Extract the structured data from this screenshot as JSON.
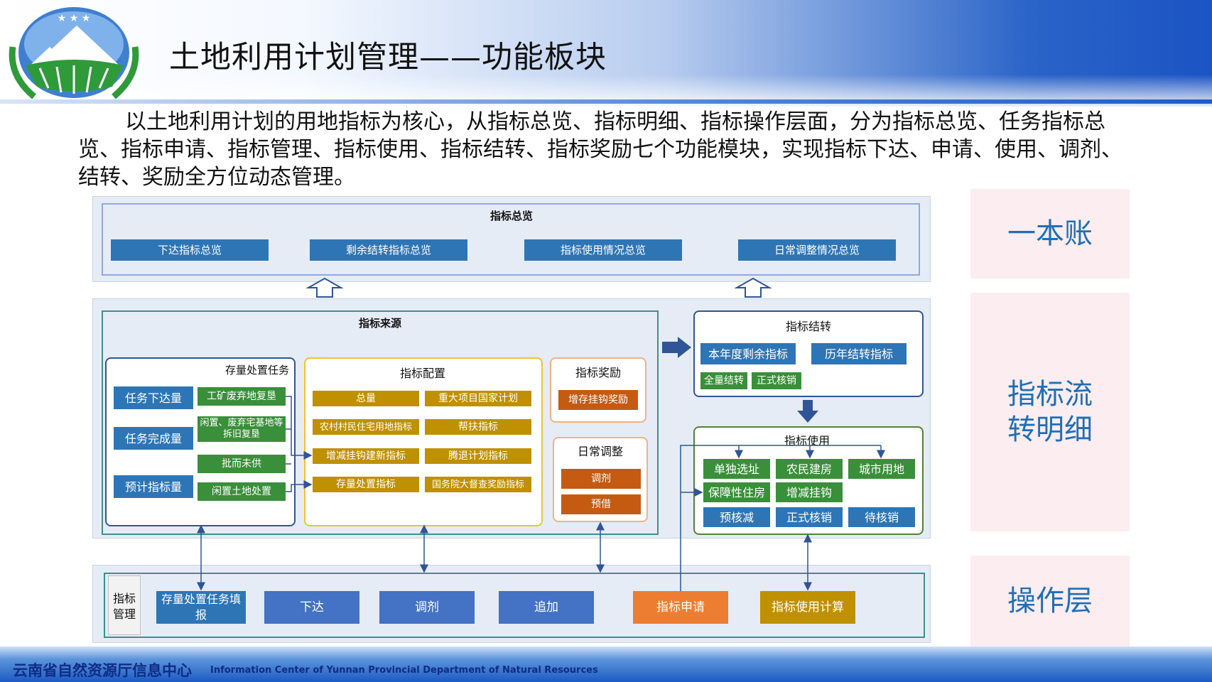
{
  "header": {
    "title": "土地利用计划管理——功能板块"
  },
  "intro": "以土地利用计划的用地指标为核心，从指标总览、指标明细、指标操作层面，分为指标总览、任务指标总览、指标申请、指标管理、指标使用、指标结转、指标奖励七个功能模块，实现指标下达、申请、使用、调剂、结转、奖励全方位动态管理。",
  "overview": {
    "title": "指标总览",
    "items": [
      "下达指标总览",
      "剩余结转指标总览",
      "指标使用情况总览",
      "日常调整情况总览"
    ]
  },
  "source": {
    "title": "指标来源",
    "stock": {
      "title": "存量处置任务",
      "left": [
        "任务下达量",
        "任务完成量",
        "预计指标量"
      ],
      "right": [
        "工矿废弃地复垦",
        "闲置、废弃宅基地等拆旧复垦",
        "批而未供",
        "闲置土地处置"
      ]
    },
    "config": {
      "title": "指标配置",
      "items": [
        "总量",
        "重大项目国家计划",
        "农村村民住宅用地指标",
        "帮扶指标",
        "增减挂钩建新指标",
        "腾退计划指标",
        "存量处置指标",
        "国务院大督查奖励指标"
      ]
    },
    "reward": {
      "title": "指标奖励",
      "item": "增存挂钩奖励"
    },
    "daily": {
      "title": "日常调整",
      "items": [
        "调剂",
        "预借"
      ]
    }
  },
  "carryover": {
    "title": "指标结转",
    "items": [
      "本年度剩余指标",
      "历年结转指标",
      "全量结转",
      "正式核销"
    ]
  },
  "usage": {
    "title": "指标使用",
    "items": [
      "单独选址",
      "农民建房",
      "城市用地",
      "保障性住房",
      "增减挂钩",
      "预核减",
      "正式核销",
      "待核销"
    ]
  },
  "operation": {
    "label": "指标管理",
    "buttons": [
      "存量处置任务填报",
      "下达",
      "调剂",
      "追加",
      "指标申请",
      "指标使用计算"
    ]
  },
  "side_labels": [
    "一本账",
    "指标流转明细",
    "操作层"
  ],
  "footer": {
    "cn": "云南省自然资源厅信息中心",
    "en": "Information Center  of Yunnan Provincial Department of Natural Resources"
  },
  "colors": {
    "blue": "#2e75b6",
    "gold": "#bf9000",
    "green": "#3a8f3a",
    "orange": "#c55a11",
    "accent": "#1f6fb8"
  }
}
